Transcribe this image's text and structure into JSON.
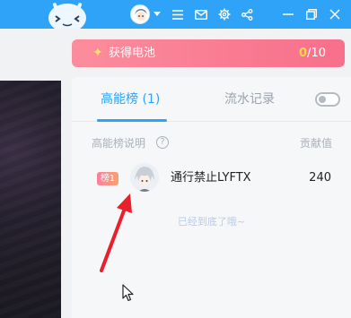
{
  "topbar": {
    "icons": {
      "mascot": "bilibili-tv-mascot-icon",
      "avatar": "user-avatar",
      "dropdown": "caret-down-icon",
      "menu": "hamburger-menu-icon",
      "mail": "mail-icon",
      "settings": "gear-icon",
      "share": "share-icon",
      "minimize": "minimize-icon",
      "restore": "restore-icon",
      "close": "close-icon"
    },
    "color": "#2ea3f7"
  },
  "battery": {
    "label": "获得电池",
    "current": "0",
    "total": "/10",
    "icon": "lightning-icon"
  },
  "panel": {
    "tabs": [
      {
        "label": "高能榜 (1)",
        "active": true
      },
      {
        "label": "流水记录",
        "active": false
      }
    ],
    "toggle_on": false,
    "rank_desc": "高能榜说明",
    "help_icon": "?",
    "contrib_header": "贡献值",
    "rows": [
      {
        "badge": "榜1",
        "name": "通行禁止LYFTX",
        "value": "240"
      }
    ],
    "end_text": "已经到底了哦~"
  }
}
